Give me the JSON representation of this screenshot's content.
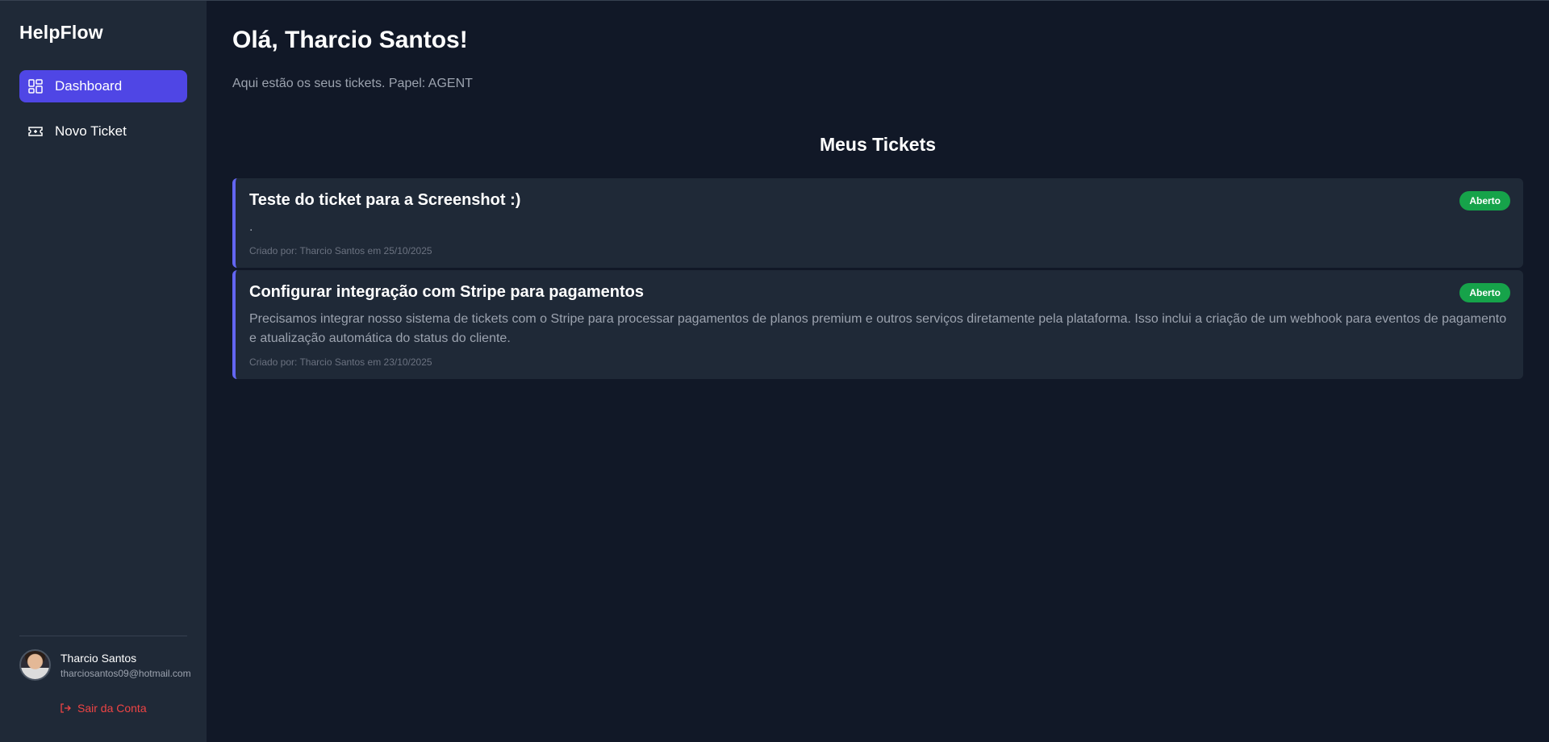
{
  "app": {
    "brand": "HelpFlow"
  },
  "sidebar": {
    "items": [
      {
        "label": "Dashboard",
        "icon": "dashboard-icon",
        "active": true
      },
      {
        "label": "Novo Ticket",
        "icon": "ticket-icon",
        "active": false
      }
    ],
    "user": {
      "name": "Tharcio Santos",
      "email": "tharciosantos09@hotmail.com"
    },
    "logout_label": "Sair da Conta"
  },
  "main": {
    "greeting": "Olá, Tharcio Santos!",
    "subtitle": "Aqui estão os seus tickets. Papel: AGENT",
    "section_title": "Meus Tickets",
    "tickets": [
      {
        "title": "Teste do ticket para a Screenshot :)",
        "status": "Aberto",
        "description": ".",
        "meta": "Criado por: Tharcio Santos em 25/10/2025"
      },
      {
        "title": "Configurar integração com Stripe para pagamentos",
        "status": "Aberto",
        "description": "Precisamos integrar nosso sistema de tickets com o Stripe para processar pagamentos de planos premium e outros serviços diretamente pela plataforma. Isso inclui a criação de um webhook para eventos de pagamento e atualização automática do status do cliente.",
        "meta": "Criado por: Tharcio Santos em 23/10/2025"
      }
    ]
  },
  "colors": {
    "accent": "#4f46e5",
    "ticket_border": "#6366f1",
    "status_open": "#16a34a",
    "logout": "#ef4444"
  }
}
